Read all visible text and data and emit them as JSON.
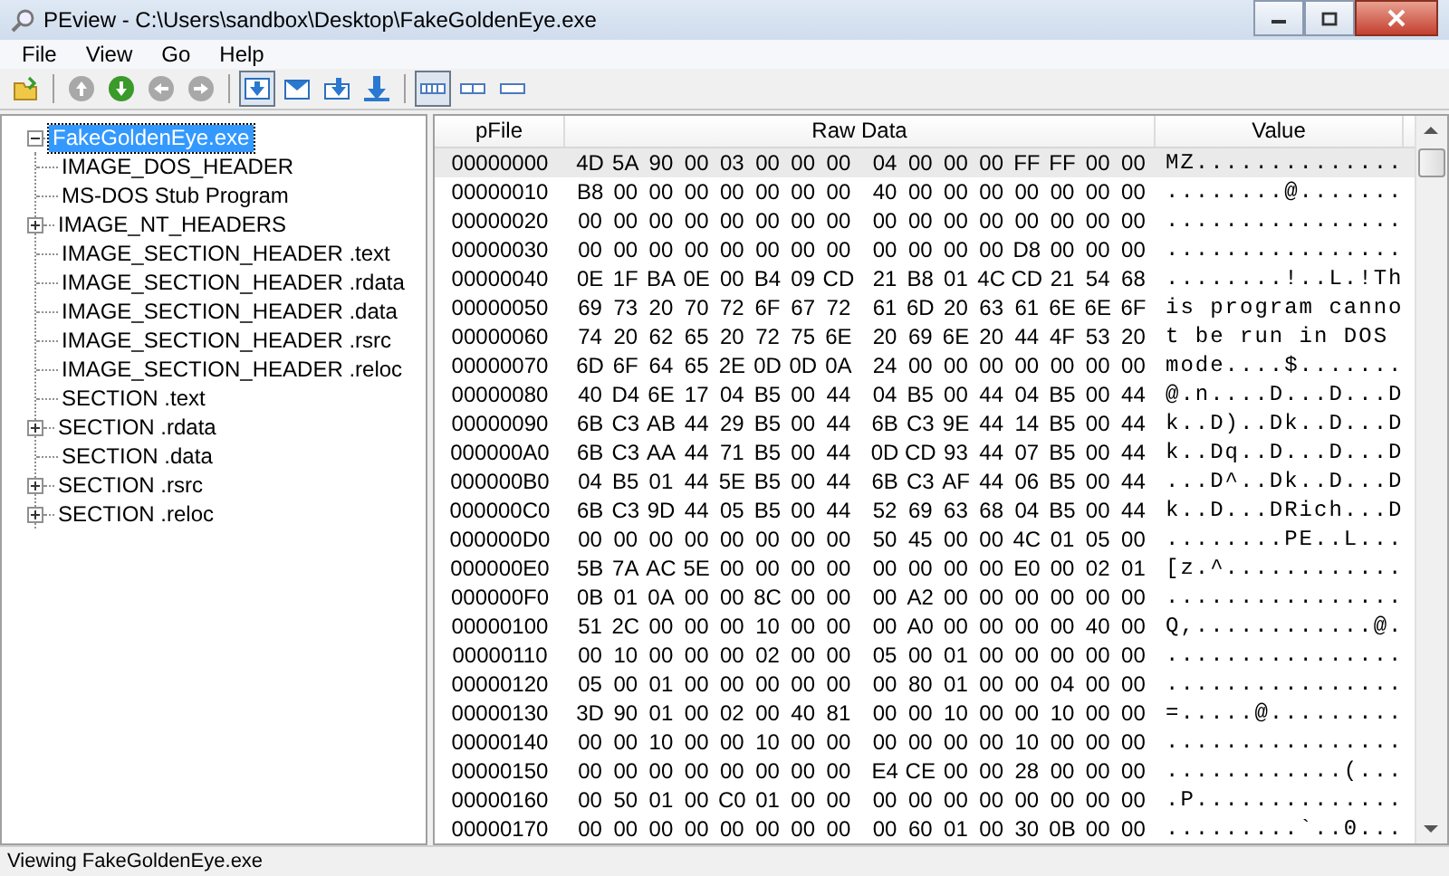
{
  "window": {
    "title": "PEview - C:\\Users\\sandbox\\Desktop\\FakeGoldenEye.exe"
  },
  "menu": [
    "File",
    "View",
    "Go",
    "Help"
  ],
  "toolbar": [
    {
      "kind": "open",
      "selected": false
    },
    {
      "kind": "separator"
    },
    {
      "kind": "up",
      "disabled": true,
      "selected": false
    },
    {
      "kind": "down",
      "disabled": false,
      "selected": false
    },
    {
      "kind": "back",
      "disabled": true,
      "selected": false
    },
    {
      "kind": "forward",
      "disabled": true,
      "selected": false
    },
    {
      "kind": "separator"
    },
    {
      "kind": "goto-a",
      "selected": true
    },
    {
      "kind": "goto-b",
      "selected": false
    },
    {
      "kind": "goto-c",
      "selected": false
    },
    {
      "kind": "goto-d",
      "selected": false
    },
    {
      "kind": "separator"
    },
    {
      "kind": "view-wide",
      "selected": true
    },
    {
      "kind": "view-medium",
      "selected": false
    },
    {
      "kind": "view-narrow",
      "selected": false
    }
  ],
  "tree": [
    {
      "label": "FakeGoldenEye.exe",
      "selected": true,
      "expanded": true,
      "children": [
        {
          "label": "IMAGE_DOS_HEADER",
          "selected": false,
          "expandable": false
        },
        {
          "label": "MS-DOS Stub Program",
          "selected": false,
          "expandable": false
        },
        {
          "label": "IMAGE_NT_HEADERS",
          "selected": false,
          "expandable": true
        },
        {
          "label": "IMAGE_SECTION_HEADER .text",
          "selected": false,
          "expandable": false
        },
        {
          "label": "IMAGE_SECTION_HEADER .rdata",
          "selected": false,
          "expandable": false
        },
        {
          "label": "IMAGE_SECTION_HEADER .data",
          "selected": false,
          "expandable": false
        },
        {
          "label": "IMAGE_SECTION_HEADER .rsrc",
          "selected": false,
          "expandable": false
        },
        {
          "label": "IMAGE_SECTION_HEADER .reloc",
          "selected": false,
          "expandable": false
        },
        {
          "label": "SECTION .text",
          "selected": false,
          "expandable": false
        },
        {
          "label": "SECTION .rdata",
          "selected": false,
          "expandable": true
        },
        {
          "label": "SECTION .data",
          "selected": false,
          "expandable": false
        },
        {
          "label": "SECTION .rsrc",
          "selected": false,
          "expandable": true
        },
        {
          "label": "SECTION .reloc",
          "selected": false,
          "expandable": true
        }
      ]
    }
  ],
  "table": {
    "columns": [
      "pFile",
      "Raw Data",
      "Value"
    ],
    "rows": [
      {
        "pfile": "00000000",
        "raw_1": "4D 5A 90 00 03 00 00 00",
        "raw_2": "04 00 00 00 FF FF 00 00",
        "value": "MZ..............",
        "selected": true
      },
      {
        "pfile": "00000010",
        "raw_1": "B8 00 00 00 00 00 00 00",
        "raw_2": "40 00 00 00 00 00 00 00",
        "value": "........@.......",
        "selected": false
      },
      {
        "pfile": "00000020",
        "raw_1": "00 00 00 00 00 00 00 00",
        "raw_2": "00 00 00 00 00 00 00 00",
        "value": "................",
        "selected": false
      },
      {
        "pfile": "00000030",
        "raw_1": "00 00 00 00 00 00 00 00",
        "raw_2": "00 00 00 00 D8 00 00 00",
        "value": "................",
        "selected": false
      },
      {
        "pfile": "00000040",
        "raw_1": "0E 1F BA 0E 00 B4 09 CD",
        "raw_2": "21 B8 01 4C CD 21 54 68",
        "value": "........!..L.!Th",
        "selected": false
      },
      {
        "pfile": "00000050",
        "raw_1": "69 73 20 70 72 6F 67 72",
        "raw_2": "61 6D 20 63 61 6E 6E 6F",
        "value": "is program canno",
        "selected": false
      },
      {
        "pfile": "00000060",
        "raw_1": "74 20 62 65 20 72 75 6E",
        "raw_2": "20 69 6E 20 44 4F 53 20",
        "value": "t be run in DOS ",
        "selected": false
      },
      {
        "pfile": "00000070",
        "raw_1": "6D 6F 64 65 2E 0D 0D 0A",
        "raw_2": "24 00 00 00 00 00 00 00",
        "value": "mode....$.......",
        "selected": false
      },
      {
        "pfile": "00000080",
        "raw_1": "40 D4 6E 17 04 B5 00 44",
        "raw_2": "04 B5 00 44 04 B5 00 44",
        "value": "@.n....D...D...D",
        "selected": false
      },
      {
        "pfile": "00000090",
        "raw_1": "6B C3 AB 44 29 B5 00 44",
        "raw_2": "6B C3 9E 44 14 B5 00 44",
        "value": "k..D)..Dk..D...D",
        "selected": false
      },
      {
        "pfile": "000000A0",
        "raw_1": "6B C3 AA 44 71 B5 00 44",
        "raw_2": "0D CD 93 44 07 B5 00 44",
        "value": "k..Dq..D...D...D",
        "selected": false
      },
      {
        "pfile": "000000B0",
        "raw_1": "04 B5 01 44 5E B5 00 44",
        "raw_2": "6B C3 AF 44 06 B5 00 44",
        "value": "...D^..Dk..D...D",
        "selected": false
      },
      {
        "pfile": "000000C0",
        "raw_1": "6B C3 9D 44 05 B5 00 44",
        "raw_2": "52 69 63 68 04 B5 00 44",
        "value": "k..D...DRich...D",
        "selected": false
      },
      {
        "pfile": "000000D0",
        "raw_1": "00 00 00 00 00 00 00 00",
        "raw_2": "50 45 00 00 4C 01 05 00",
        "value": "........PE..L...",
        "selected": false
      },
      {
        "pfile": "000000E0",
        "raw_1": "5B 7A AC 5E 00 00 00 00",
        "raw_2": "00 00 00 00 E0 00 02 01",
        "value": "[z.^............",
        "selected": false
      },
      {
        "pfile": "000000F0",
        "raw_1": "0B 01 0A 00 00 8C 00 00",
        "raw_2": "00 A2 00 00 00 00 00 00",
        "value": "................",
        "selected": false
      },
      {
        "pfile": "00000100",
        "raw_1": "51 2C 00 00 00 10 00 00",
        "raw_2": "00 A0 00 00 00 00 40 00",
        "value": "Q,............@.",
        "selected": false
      },
      {
        "pfile": "00000110",
        "raw_1": "00 10 00 00 00 02 00 00",
        "raw_2": "05 00 01 00 00 00 00 00",
        "value": "................",
        "selected": false
      },
      {
        "pfile": "00000120",
        "raw_1": "05 00 01 00 00 00 00 00",
        "raw_2": "00 80 01 00 00 04 00 00",
        "value": "................",
        "selected": false
      },
      {
        "pfile": "00000130",
        "raw_1": "3D 90 01 00 02 00 40 81",
        "raw_2": "00 00 10 00 00 10 00 00",
        "value": "=.....@.........",
        "selected": false
      },
      {
        "pfile": "00000140",
        "raw_1": "00 00 10 00 00 10 00 00",
        "raw_2": "00 00 00 00 10 00 00 00",
        "value": "................",
        "selected": false
      },
      {
        "pfile": "00000150",
        "raw_1": "00 00 00 00 00 00 00 00",
        "raw_2": "E4 CE 00 00 28 00 00 00",
        "value": "............(...",
        "selected": false
      },
      {
        "pfile": "00000160",
        "raw_1": "00 50 01 00 C0 01 00 00",
        "raw_2": "00 00 00 00 00 00 00 00",
        "value": ".P..............",
        "selected": false
      },
      {
        "pfile": "00000170",
        "raw_1": "00 00 00 00 00 00 00 00",
        "raw_2": "00 60 01 00 30 0B 00 00",
        "value": ".........`..0...",
        "selected": false
      }
    ]
  },
  "status_bar": "Viewing FakeGoldenEye.exe"
}
